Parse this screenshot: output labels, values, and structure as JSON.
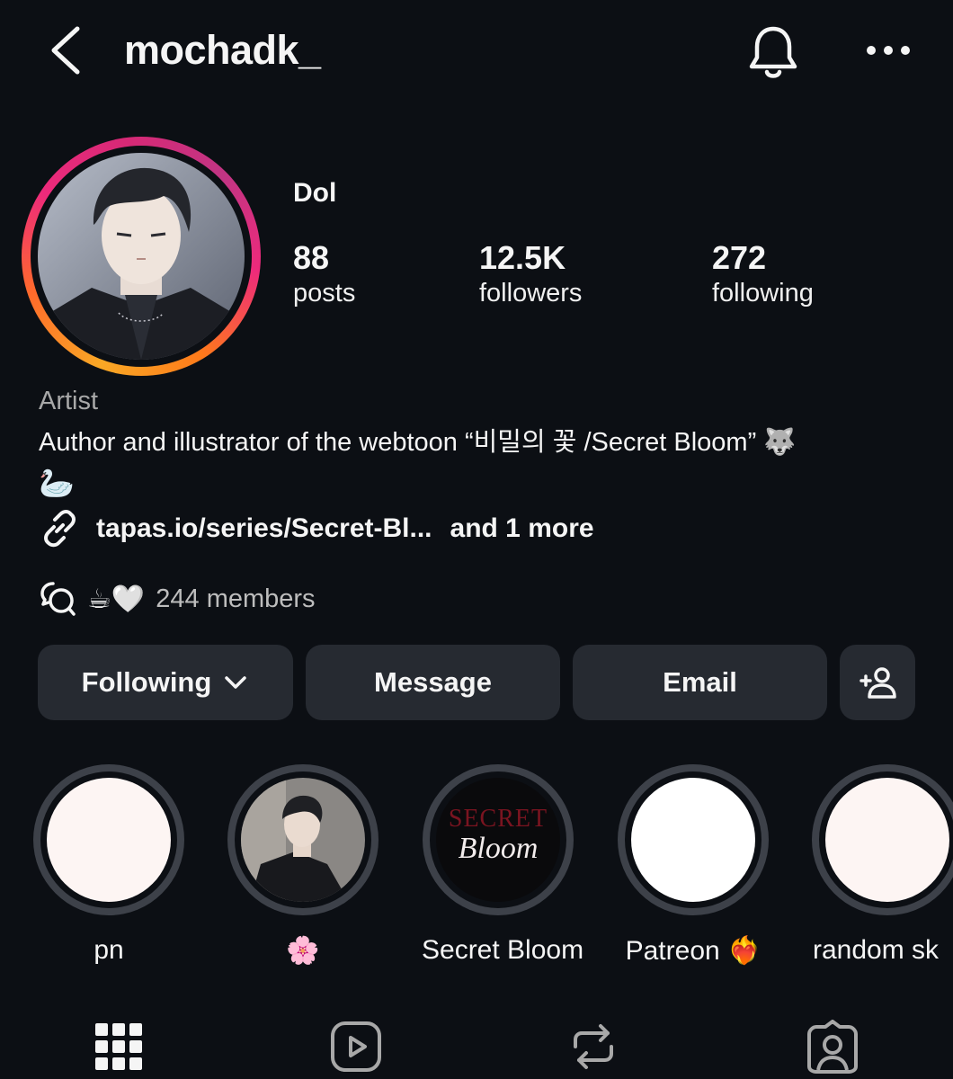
{
  "header": {
    "username": "mochadk_"
  },
  "profile": {
    "display_name": "Dol",
    "stats": [
      {
        "value": "88",
        "label": "posts"
      },
      {
        "value": "12.5K",
        "label": "followers"
      },
      {
        "value": "272",
        "label": "following"
      }
    ],
    "category": "Artist",
    "bio": "Author and illustrator of the webtoon “비밀의 꽃 /Secret Bloom” 🐺",
    "bio_line2": "🦢",
    "link": {
      "text": "tapas.io/series/Secret-Bl...",
      "more": "and 1 more"
    },
    "channel": {
      "emojis": "☕🤍",
      "members": "244 members"
    }
  },
  "actions": {
    "following": "Following",
    "message": "Message",
    "email": "Email"
  },
  "highlights": [
    {
      "label": "pn"
    },
    {
      "label": "🌸"
    },
    {
      "label": "Secret Bloom",
      "cover_text_top": "SECRET",
      "cover_text_bottom": "Bloom"
    },
    {
      "label": "Patreon ❤️‍🔥"
    },
    {
      "label": "random sk"
    }
  ],
  "colors": {
    "background": "#0c0f14",
    "button": "#262a31",
    "highlight_ring": "#3d4149",
    "secondary_text": "#a8a8a8"
  }
}
